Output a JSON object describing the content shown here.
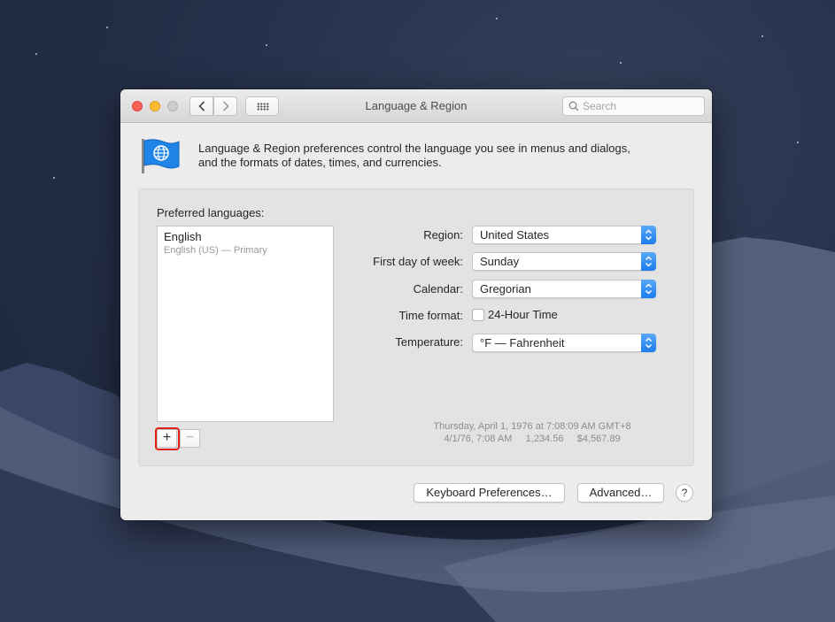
{
  "window": {
    "title": "Language & Region",
    "search_placeholder": "Search"
  },
  "header": {
    "description_line1": "Language & Region preferences control the language you see in menus and dialogs,",
    "description_line2": "and the formats of dates, times, and currencies."
  },
  "languages": {
    "label": "Preferred languages:",
    "items": [
      {
        "name": "English",
        "detail": "English (US) — Primary"
      }
    ],
    "add_label": "+",
    "remove_label": "−"
  },
  "settings": {
    "region": {
      "label": "Region:",
      "value": "United States"
    },
    "first_day": {
      "label": "First day of week:",
      "value": "Sunday"
    },
    "calendar": {
      "label": "Calendar:",
      "value": "Gregorian"
    },
    "time_format": {
      "label": "Time format:",
      "option": "24-Hour Time",
      "checked": false
    },
    "temperature": {
      "label": "Temperature:",
      "value": "°F — Fahrenheit"
    }
  },
  "sample": {
    "line1": "Thursday, April 1, 1976 at 7:08:09 AM GMT+8",
    "line2": "4/1/76, 7:08 AM     1,234.56     $4,567.89"
  },
  "footer": {
    "keyboard_label": "Keyboard Preferences…",
    "advanced_label": "Advanced…",
    "help_label": "?"
  },
  "colors": {
    "accent": "#1a7cf0",
    "highlight": "#e0211b"
  }
}
